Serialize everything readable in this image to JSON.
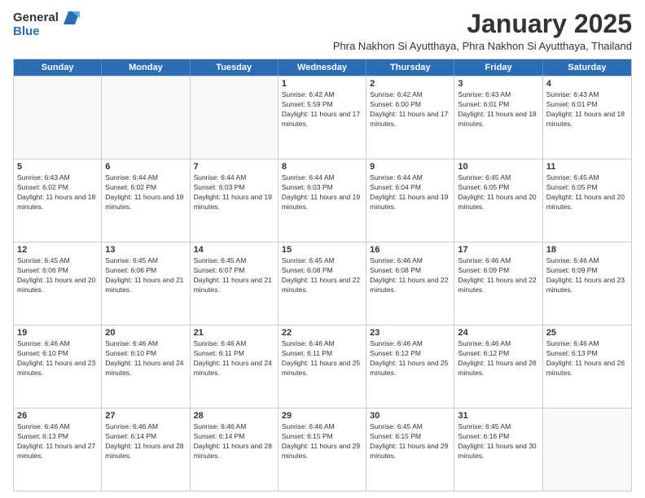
{
  "header": {
    "logo_general": "General",
    "logo_blue": "Blue",
    "month_title": "January 2025",
    "location": "Phra Nakhon Si Ayutthaya, Phra Nakhon Si Ayutthaya, Thailand"
  },
  "calendar": {
    "days_of_week": [
      "Sunday",
      "Monday",
      "Tuesday",
      "Wednesday",
      "Thursday",
      "Friday",
      "Saturday"
    ],
    "weeks": [
      [
        {
          "day": "",
          "empty": true
        },
        {
          "day": "",
          "empty": true
        },
        {
          "day": "",
          "empty": true
        },
        {
          "day": "1",
          "sunrise": "6:42 AM",
          "sunset": "5:59 PM",
          "daylight": "11 hours and 17 minutes."
        },
        {
          "day": "2",
          "sunrise": "6:42 AM",
          "sunset": "6:00 PM",
          "daylight": "11 hours and 17 minutes."
        },
        {
          "day": "3",
          "sunrise": "6:43 AM",
          "sunset": "6:01 PM",
          "daylight": "11 hours and 18 minutes."
        },
        {
          "day": "4",
          "sunrise": "6:43 AM",
          "sunset": "6:01 PM",
          "daylight": "11 hours and 18 minutes."
        }
      ],
      [
        {
          "day": "5",
          "sunrise": "6:43 AM",
          "sunset": "6:02 PM",
          "daylight": "11 hours and 18 minutes."
        },
        {
          "day": "6",
          "sunrise": "6:44 AM",
          "sunset": "6:02 PM",
          "daylight": "11 hours and 18 minutes."
        },
        {
          "day": "7",
          "sunrise": "6:44 AM",
          "sunset": "6:03 PM",
          "daylight": "11 hours and 19 minutes."
        },
        {
          "day": "8",
          "sunrise": "6:44 AM",
          "sunset": "6:03 PM",
          "daylight": "11 hours and 19 minutes."
        },
        {
          "day": "9",
          "sunrise": "6:44 AM",
          "sunset": "6:04 PM",
          "daylight": "11 hours and 19 minutes."
        },
        {
          "day": "10",
          "sunrise": "6:45 AM",
          "sunset": "6:05 PM",
          "daylight": "11 hours and 20 minutes."
        },
        {
          "day": "11",
          "sunrise": "6:45 AM",
          "sunset": "6:05 PM",
          "daylight": "11 hours and 20 minutes."
        }
      ],
      [
        {
          "day": "12",
          "sunrise": "6:45 AM",
          "sunset": "6:06 PM",
          "daylight": "11 hours and 20 minutes."
        },
        {
          "day": "13",
          "sunrise": "6:45 AM",
          "sunset": "6:06 PM",
          "daylight": "11 hours and 21 minutes."
        },
        {
          "day": "14",
          "sunrise": "6:45 AM",
          "sunset": "6:07 PM",
          "daylight": "11 hours and 21 minutes."
        },
        {
          "day": "15",
          "sunrise": "6:45 AM",
          "sunset": "6:08 PM",
          "daylight": "11 hours and 22 minutes."
        },
        {
          "day": "16",
          "sunrise": "6:46 AM",
          "sunset": "6:08 PM",
          "daylight": "11 hours and 22 minutes."
        },
        {
          "day": "17",
          "sunrise": "6:46 AM",
          "sunset": "6:09 PM",
          "daylight": "11 hours and 22 minutes."
        },
        {
          "day": "18",
          "sunrise": "6:46 AM",
          "sunset": "6:09 PM",
          "daylight": "11 hours and 23 minutes."
        }
      ],
      [
        {
          "day": "19",
          "sunrise": "6:46 AM",
          "sunset": "6:10 PM",
          "daylight": "11 hours and 23 minutes."
        },
        {
          "day": "20",
          "sunrise": "6:46 AM",
          "sunset": "6:10 PM",
          "daylight": "11 hours and 24 minutes."
        },
        {
          "day": "21",
          "sunrise": "6:46 AM",
          "sunset": "6:11 PM",
          "daylight": "11 hours and 24 minutes."
        },
        {
          "day": "22",
          "sunrise": "6:46 AM",
          "sunset": "6:11 PM",
          "daylight": "11 hours and 25 minutes."
        },
        {
          "day": "23",
          "sunrise": "6:46 AM",
          "sunset": "6:12 PM",
          "daylight": "11 hours and 25 minutes."
        },
        {
          "day": "24",
          "sunrise": "6:46 AM",
          "sunset": "6:12 PM",
          "daylight": "11 hours and 26 minutes."
        },
        {
          "day": "25",
          "sunrise": "6:46 AM",
          "sunset": "6:13 PM",
          "daylight": "11 hours and 26 minutes."
        }
      ],
      [
        {
          "day": "26",
          "sunrise": "6:46 AM",
          "sunset": "6:13 PM",
          "daylight": "11 hours and 27 minutes."
        },
        {
          "day": "27",
          "sunrise": "6:46 AM",
          "sunset": "6:14 PM",
          "daylight": "11 hours and 28 minutes."
        },
        {
          "day": "28",
          "sunrise": "6:46 AM",
          "sunset": "6:14 PM",
          "daylight": "11 hours and 28 minutes."
        },
        {
          "day": "29",
          "sunrise": "6:46 AM",
          "sunset": "6:15 PM",
          "daylight": "11 hours and 29 minutes."
        },
        {
          "day": "30",
          "sunrise": "6:45 AM",
          "sunset": "6:15 PM",
          "daylight": "11 hours and 29 minutes."
        },
        {
          "day": "31",
          "sunrise": "6:45 AM",
          "sunset": "6:16 PM",
          "daylight": "11 hours and 30 minutes."
        },
        {
          "day": "",
          "empty": true
        }
      ]
    ]
  }
}
